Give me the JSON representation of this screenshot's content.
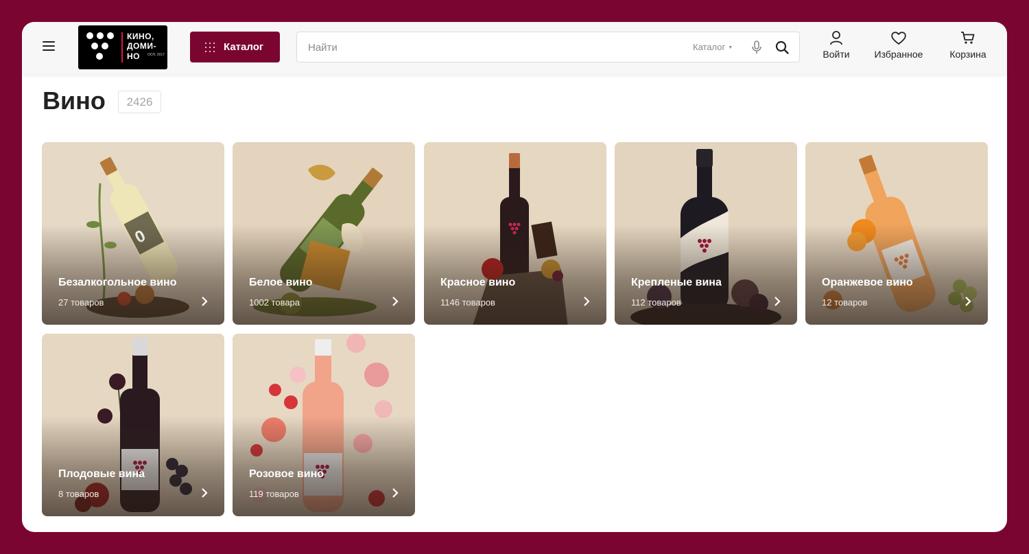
{
  "header": {
    "logo": {
      "line1": "КИНО,",
      "line2": "ДОМИ-",
      "line3": "НО",
      "est": "ОСН. 2017"
    },
    "catalog_button": "Каталог",
    "search": {
      "placeholder": "Найти",
      "scope": "Каталог"
    },
    "actions": {
      "login": "Войти",
      "favorites": "Избранное",
      "cart": "Корзина"
    }
  },
  "page": {
    "title": "Вино",
    "count": "2426"
  },
  "categories": [
    {
      "name": "Безалкогольное вино",
      "count": "27 товаров"
    },
    {
      "name": "Белое вино",
      "count": "1002 товара"
    },
    {
      "name": "Красное вино",
      "count": "1146 товаров"
    },
    {
      "name": "Крепленые вина",
      "count": "112 товаров"
    },
    {
      "name": "Оранжевое вино",
      "count": "12 товаров"
    },
    {
      "name": "Плодовые вина",
      "count": "8 товаров"
    },
    {
      "name": "Розовое вино",
      "count": "119 товаров"
    }
  ],
  "colors": {
    "brand": "#7a0530",
    "card_bg": "#e4d6c2"
  }
}
